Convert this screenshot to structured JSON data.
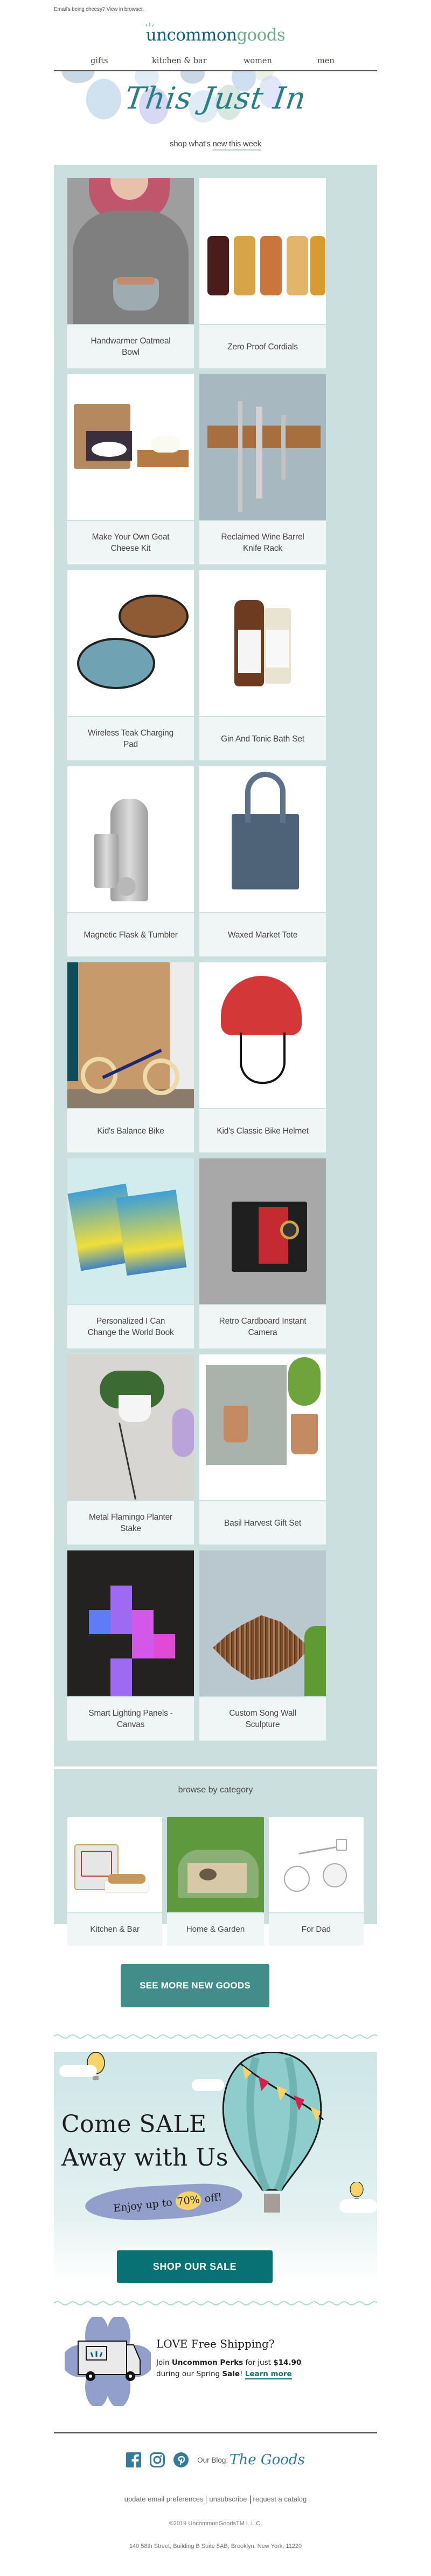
{
  "preheader": {
    "text": "Email's being cheesy? View in browser."
  },
  "logo": {
    "part1": "uncommon",
    "part2": "goods"
  },
  "nav": [
    {
      "label": "gifts"
    },
    {
      "label": "kitchen & bar"
    },
    {
      "label": "women"
    },
    {
      "label": "men"
    }
  ],
  "hero": {
    "title": "This Just In",
    "subtitle_prefix": "shop what's",
    "subtitle_link": "new this week"
  },
  "products": [
    {
      "name": "Handwarmer Oatmeal Bowl"
    },
    {
      "name": "Zero Proof Cordials"
    },
    {
      "name": "Make Your Own Goat Cheese Kit"
    },
    {
      "name": "Reclaimed Wine Barrel Knife Rack"
    },
    {
      "name": "Wireless Teak Charging Pad"
    },
    {
      "name": "Gin And Tonic Bath Set"
    },
    {
      "name": "Magnetic Flask & Tumbler"
    },
    {
      "name": "Waxed Market Tote"
    },
    {
      "name": "Kid's Balance Bike"
    },
    {
      "name": "Kid's Classic Bike Helmet"
    },
    {
      "name": "Personalized I Can Change the World Book"
    },
    {
      "name": "Retro Cardboard Instant Camera"
    },
    {
      "name": "Metal Flamingo Planter Stake"
    },
    {
      "name": "Basil Harvest Gift Set"
    },
    {
      "name": "Smart Lighting Panels - Canvas"
    },
    {
      "name": "Custom Song Wall Sculpture"
    }
  ],
  "categories": {
    "title": "browse by category",
    "items": [
      {
        "label": "Kitchen & Bar"
      },
      {
        "label": "Home & Garden"
      },
      {
        "label": "For Dad"
      }
    ]
  },
  "see_more": {
    "label": "SEE MORE NEW GOODS"
  },
  "sale": {
    "title_line1": "Come SALE",
    "title_line2": "Away with Us",
    "banner_prefix": "Enjoy up to",
    "banner_pct": "70%",
    "banner_suffix": "off!",
    "button": "SHOP OUR SALE"
  },
  "perks": {
    "title": "LOVE Free Shipping?",
    "join": "Join",
    "program": "Uncommon Perks",
    "for_just": "for just",
    "price": "$14.90",
    "during": "during our Spring",
    "sale_word": "Sale",
    "bang": "!",
    "learn_more": "Learn more"
  },
  "footer": {
    "social": [
      "facebook",
      "instagram",
      "pinterest"
    ],
    "blog_label": "Our Blog:",
    "blog_name": "The Goods",
    "links": [
      {
        "label": "update email preferences"
      },
      {
        "label": "unsubscribe"
      },
      {
        "label": "request a catalog"
      }
    ],
    "copyright": "©2019 UncommonGoodsTM L.L.C.",
    "address": "140 58th Street, Building B Suite 5AB, Brooklyn, New York, 11220"
  },
  "colors": {
    "brand_blue": "#0e5e7e",
    "brand_green": "#6aae84",
    "panel_bg": "#cbdfdf",
    "label_bg": "#f0f6f6",
    "button_teal": "#428c89",
    "sale_button": "#077173",
    "banner_purple": "#939fcb",
    "accent_yellow": "#f7d36a"
  }
}
